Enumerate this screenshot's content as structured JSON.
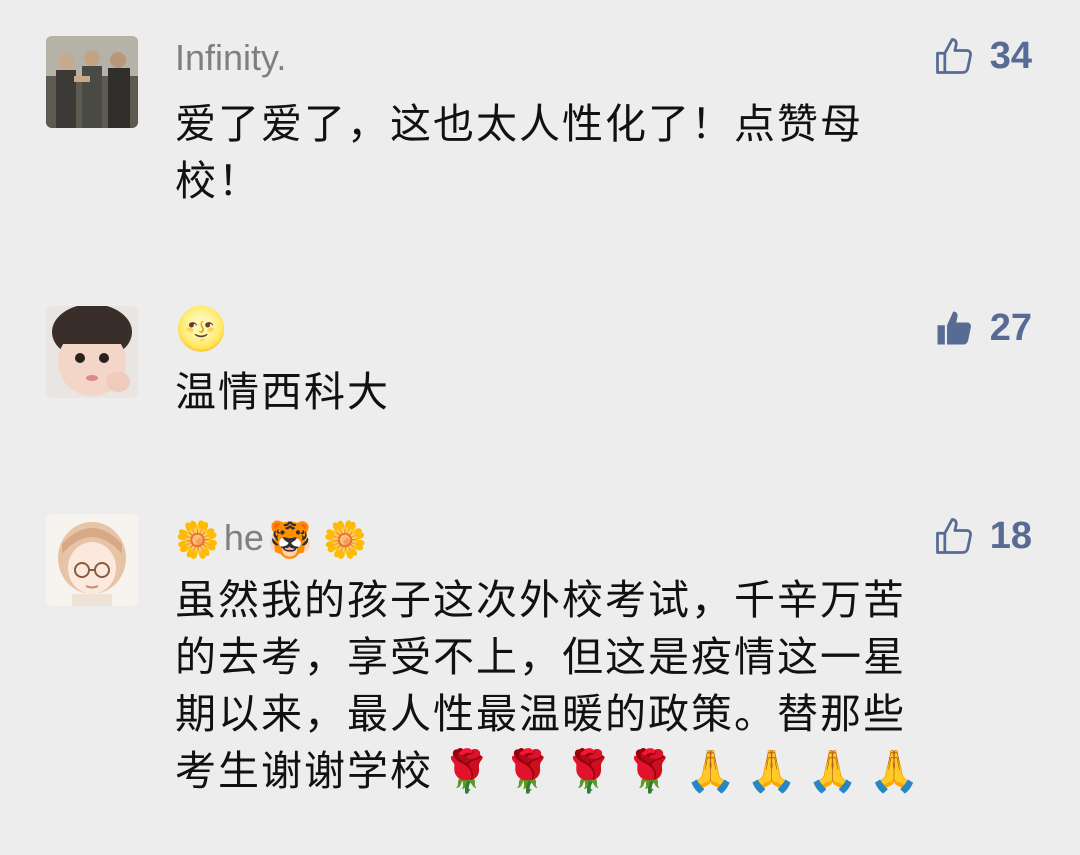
{
  "comments": [
    {
      "username": "Infinity.",
      "likes": "34",
      "liked": false,
      "avatar": "group-of-men-photo",
      "text_lines": [
        "爱了爱了，这也太人性化了！点赞母",
        "校！"
      ]
    },
    {
      "username": "🌝",
      "likes": "27",
      "liked": true,
      "avatar": "baby-photo",
      "text_lines": [
        "温情西科大"
      ]
    },
    {
      "username_parts": [
        "🌼",
        "he",
        "🐯",
        "🌼"
      ],
      "likes": "18",
      "liked": false,
      "avatar": "anime-girl-drawing",
      "text_lines": [
        "虽然我的孩子这次外校考试，千辛万苦",
        "的去考，享受不上，但这是疫情这一星",
        "期以来，最人性最温暖的政策。替那些",
        "考生谢谢学校"
      ],
      "trailing_emoji": [
        "🌹",
        "🌹",
        "🌹",
        "🌹",
        "🙏",
        "🙏",
        "🙏",
        "🙏"
      ]
    }
  ],
  "colors": {
    "background": "#ededed",
    "username": "#7f7f7f",
    "like_accent": "#576b95",
    "text": "#111111"
  }
}
